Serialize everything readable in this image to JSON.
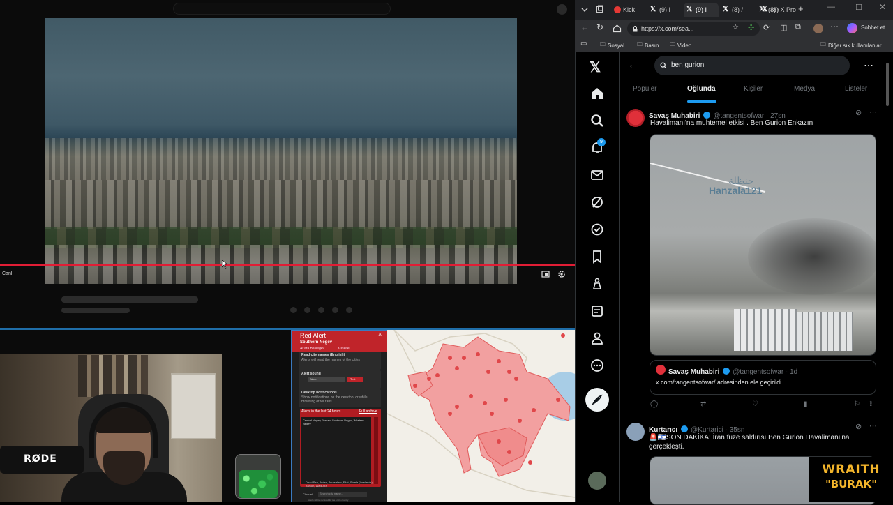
{
  "stream": {
    "cc_label": "Canlı"
  },
  "red_alert": {
    "title": "Red Alert",
    "region": "Southern Negev",
    "place_a": "Ar'ara BaNegev",
    "place_b": "Kuseife",
    "opt1_title": "Read city names (English)",
    "opt1_desc": "Alerts will read the names of the cities",
    "opt2_title": "Alert sound",
    "opt2_value": "Alarm",
    "opt2_test": "Test",
    "opt3_title": "Desktop notifications",
    "opt3_desc": "Show notifications on the desktop, or while browsing other tabs",
    "alerts_heading": "Alerts in the last 24 hours",
    "alerts_link": "Full archive",
    "alerts_body": "Central Negev, Jordan, Southern Negev, Western Negev",
    "dead_sea": "Dead Sea, Judea, Jerusalem, Eilat, Shfela (Lowlands), Yarkon, Wadi Ara",
    "clear_all": "Clear all",
    "search_placeholder": "Search city name...",
    "footnote": "Alerts will be received for the entire country"
  },
  "browser": {
    "tabs": [
      {
        "label": "Kick"
      },
      {
        "label": "(9) I"
      },
      {
        "label": "(9) I"
      },
      {
        "label": "(8) /"
      },
      {
        "label": "(8) /"
      },
      {
        "label": "(8) X Pro"
      }
    ],
    "url": "https://x.com/sea...",
    "copilot_label": "Sohbet et",
    "bookmarks": [
      "Sosyal",
      "Basın",
      "Video"
    ],
    "other_bookmarks": "Diğer sık kullanılanlar"
  },
  "x": {
    "search_value": "ben gurion",
    "notif_count": "9",
    "tabs": [
      "Popüler",
      "Oğlunda",
      "Kişiler",
      "Medya",
      "Listeler"
    ],
    "post1": {
      "name": "Savaş Muhabiri",
      "handle": "@tangentsofwar · 27sn",
      "text": "Havalimanı'na muhtemel etkisi . Ben Gurion Enkazın",
      "watermark": "Hanzala121",
      "watermark_ar": "حنظلة",
      "quote_name": "Savaş Muhabiri",
      "quote_handle": "@tangentsofwar · 1d",
      "quote_text": "x.com/tangentsofwar/ adresinden ele geçirildi..."
    },
    "post2": {
      "name": "Kurtarıcı",
      "handle": "@Kurtarici · 35sn",
      "text": "🚨🇮🇱SON DAKİKA: İran füze saldırısı Ben Gurion Havalimanı'na gerçekleşti."
    }
  },
  "overlay": {
    "line1": "WRAITH",
    "line2": "\"BURAK\""
  },
  "colors": {
    "accent_blue": "#1d9bf0",
    "alert_red": "#c0242a",
    "progress_red": "#e11d35",
    "brand_gold": "#f3b52b"
  }
}
